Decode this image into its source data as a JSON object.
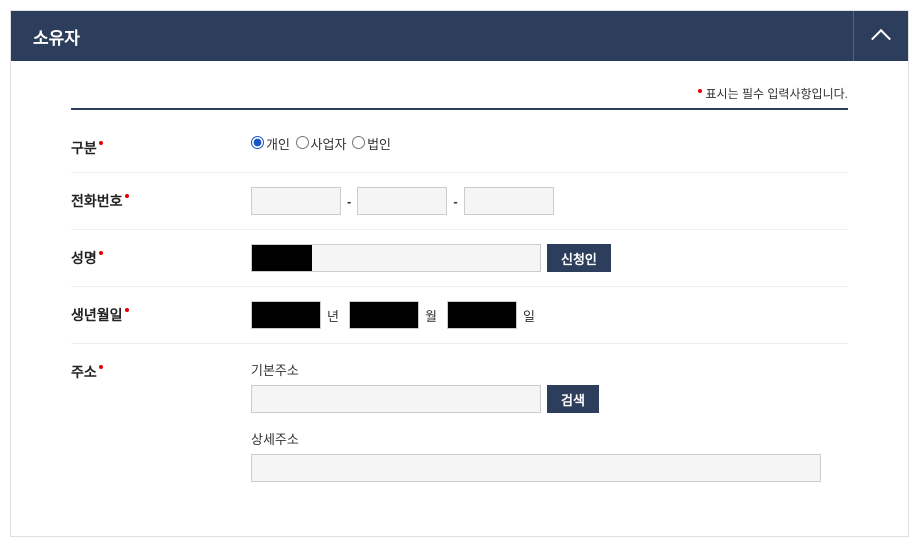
{
  "header": {
    "title": "소유자"
  },
  "note": {
    "text": "표시는 필수 입력사항입니다."
  },
  "labels": {
    "category": "구분",
    "phone": "전화번호",
    "name": "성명",
    "birth": "생년월일",
    "address": "주소"
  },
  "category": {
    "opt1": "개인",
    "opt2": "사업자",
    "opt3": "법인",
    "selected": "개인"
  },
  "phone": {
    "sep": "-",
    "part1": "",
    "part2": "",
    "part3": ""
  },
  "name": {
    "value": "",
    "applicant_btn": "신청인"
  },
  "birth": {
    "year": "",
    "month": "",
    "day": "",
    "unit_year": "년",
    "unit_month": "월",
    "unit_day": "일"
  },
  "address": {
    "base_label": "기본주소",
    "base_value": "",
    "search_btn": "검색",
    "detail_label": "상세주소",
    "detail_value": ""
  }
}
